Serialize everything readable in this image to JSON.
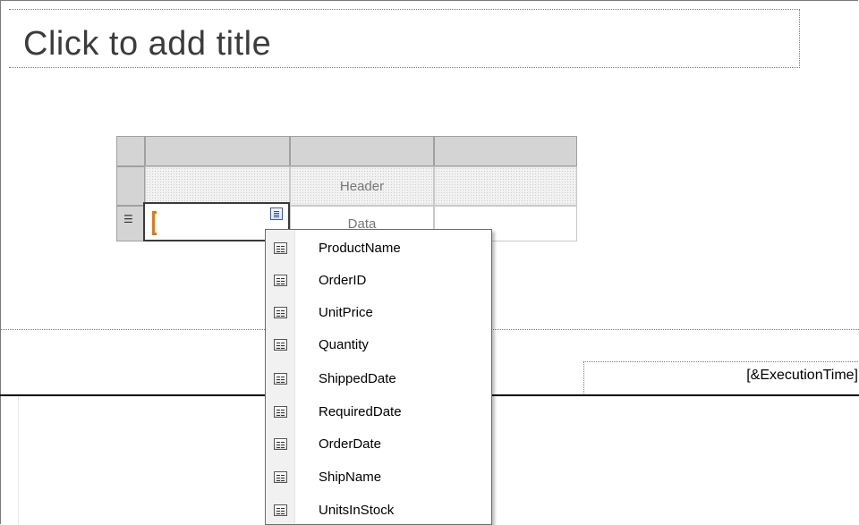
{
  "slide": {
    "title_placeholder": "Click to add title"
  },
  "tablix": {
    "header_label": "Header",
    "data_label": "Data",
    "row_handle_icon": "three-lines-icon"
  },
  "field_list": {
    "items": [
      {
        "label": "ProductName",
        "icon": "field-icon"
      },
      {
        "label": "OrderID",
        "icon": "field-icon"
      },
      {
        "label": "UnitPrice",
        "icon": "field-icon"
      },
      {
        "label": "Quantity",
        "icon": "field-icon"
      },
      {
        "label": "ShippedDate",
        "icon": "field-icon"
      },
      {
        "label": "RequiredDate",
        "icon": "field-icon"
      },
      {
        "label": "OrderDate",
        "icon": "field-icon"
      },
      {
        "label": "ShipName",
        "icon": "field-icon"
      },
      {
        "label": "UnitsInStock",
        "icon": "field-icon"
      }
    ]
  },
  "footer": {
    "execution_time": "[&ExecutionTime]"
  },
  "colors": {
    "selection_bracket": "#e0781c",
    "handle_gray": "#d4d4d4"
  }
}
